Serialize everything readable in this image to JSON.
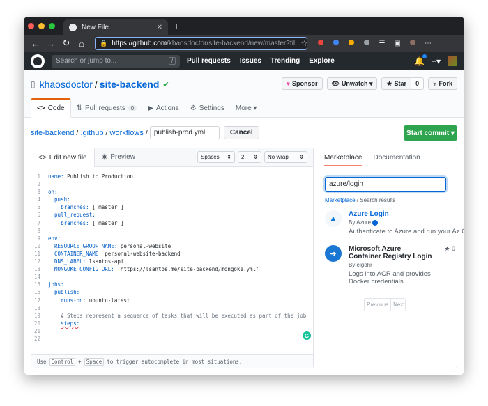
{
  "browser": {
    "tab_title": "New File",
    "newtab_glyph": "+",
    "url_host": "https://github.com",
    "url_path": "/khaosdoctor/site-backend/new/master?fil..."
  },
  "github": {
    "search_placeholder": "Search or jump to...",
    "search_key": "/",
    "nav": [
      "Pull requests",
      "Issues",
      "Trending",
      "Explore"
    ],
    "plus_label": "+▾"
  },
  "repo": {
    "owner": "khaosdoctor",
    "separator": "/",
    "name": "site-backend",
    "sponsor_label": "Sponsor",
    "unwatch_label": "Unwatch ▾",
    "star_label": "Star",
    "star_count": "0",
    "fork_label": "Fork",
    "tabs": [
      {
        "icon": "<>",
        "label": "Code",
        "count": ""
      },
      {
        "icon": "⇅",
        "label": "Pull requests",
        "count": "0"
      },
      {
        "icon": "▶",
        "label": "Actions",
        "count": ""
      },
      {
        "icon": "⚙",
        "label": "Settings",
        "count": ""
      },
      {
        "icon": "",
        "label": "More ▾",
        "count": ""
      }
    ]
  },
  "breadcrumb": {
    "repo": "site-backend",
    "sep": "/",
    "dir1": ".github",
    "dir2": "workflows",
    "filename": "publish-prod.yml",
    "cancel_label": "Cancel",
    "commit_label": "Start commit ▾"
  },
  "editor": {
    "edit_tab": "Edit new file",
    "preview_tab": "Preview",
    "indent_mode": "Spaces",
    "indent_size": "2",
    "wrap_mode": "No wrap",
    "footer_use": "Use",
    "footer_key1": "Control",
    "footer_plus": "+",
    "footer_key2": "Space",
    "footer_text": "to trigger autocomplete in most situations.",
    "lines": [
      {
        "n": "1",
        "ind": "",
        "k": "name:",
        "v": " Publish to Production"
      },
      {
        "n": "2",
        "ind": "",
        "k": "",
        "v": ""
      },
      {
        "n": "3",
        "ind": "",
        "k": "on:",
        "v": ""
      },
      {
        "n": "4",
        "ind": "  ",
        "k": "push:",
        "v": ""
      },
      {
        "n": "5",
        "ind": "    ",
        "k": "branches:",
        "v": " [ master ]"
      },
      {
        "n": "6",
        "ind": "  ",
        "k": "pull_request:",
        "v": ""
      },
      {
        "n": "7",
        "ind": "    ",
        "k": "branches:",
        "v": " [ master ]"
      },
      {
        "n": "8",
        "ind": "",
        "k": "",
        "v": ""
      },
      {
        "n": "9",
        "ind": "",
        "k": "env:",
        "v": ""
      },
      {
        "n": "10",
        "ind": "  ",
        "k": "RESOURCE_GROUP_NAME:",
        "v": " personal-website"
      },
      {
        "n": "11",
        "ind": "  ",
        "k": "CONTAINER_NAME:",
        "v": " personal-website-backend"
      },
      {
        "n": "12",
        "ind": "  ",
        "k": "DNS_LABEL:",
        "v": " lsantos-api"
      },
      {
        "n": "13",
        "ind": "  ",
        "k": "MONGOKE_CONFIG_URL:",
        "v": " 'https://lsantos.me/site-backend/mongoke.yml'"
      },
      {
        "n": "14",
        "ind": "",
        "k": "",
        "v": ""
      },
      {
        "n": "15",
        "ind": "",
        "k": "jobs:",
        "v": ""
      },
      {
        "n": "16",
        "ind": "  ",
        "k": "publish:",
        "v": ""
      },
      {
        "n": "17",
        "ind": "    ",
        "k": "runs-on:",
        "v": " ubuntu-latest"
      },
      {
        "n": "18",
        "ind": "",
        "k": "",
        "v": ""
      },
      {
        "n": "19",
        "ind": "    ",
        "k": "",
        "v": "# Steps represent a sequence of tasks that will be executed as part of the job"
      },
      {
        "n": "20",
        "ind": "    ",
        "k": "steps:",
        "v": ""
      },
      {
        "n": "21",
        "ind": "",
        "k": "",
        "v": ""
      },
      {
        "n": "22",
        "ind": "",
        "k": "",
        "v": ""
      }
    ]
  },
  "marketplace": {
    "tab_marketplace": "Marketplace",
    "tab_docs": "Documentation",
    "search_value": "azure/login",
    "crumb_link": "Marketplace",
    "crumb_rest": " / Search results",
    "results": [
      {
        "name": "Azure Login",
        "by": "By Azure",
        "desc": "Authenticate to Azure and run your Az C",
        "stars": ""
      },
      {
        "name": "Microsoft Azure Container Registry Login",
        "by": "By elgohr",
        "desc": "Logs into ACR and provides Docker credentials",
        "stars": "★ 0"
      }
    ],
    "prev_label": "Previous",
    "next_label": "Next"
  },
  "colors": {
    "accent": "#0366d6",
    "commit_green": "#2ea44f",
    "tab_orange": "#e36209",
    "header_dark": "#24292e"
  }
}
